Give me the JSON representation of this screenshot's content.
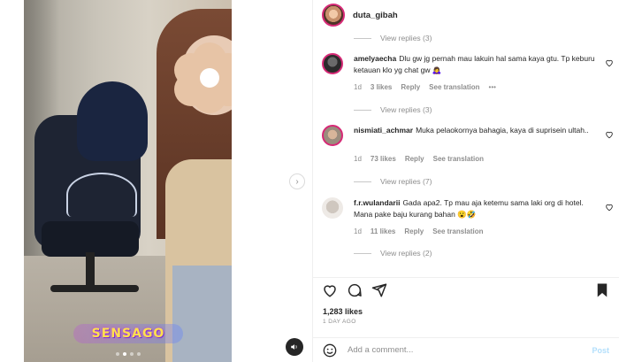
{
  "header": {
    "username": "duta_gibah"
  },
  "media": {
    "sticker_text": "SENSAGO",
    "carousel_pages": 4,
    "active_page": 2
  },
  "top_view_replies": "View replies (3)",
  "comments": [
    {
      "username": "amelyaecha",
      "text": "Dlu gw jg pernah mau lakuin hal sama kaya gtu. Tp keburu ketauan klo yg chat gw 🙇‍♀️",
      "time": "1d",
      "likes": "3 likes",
      "reply": "Reply",
      "translate": "See translation",
      "more": "•••",
      "view_replies": "View replies (3)"
    },
    {
      "username": "nismiati_achmar",
      "text": "Muka pelaokornya bahagia, kaya di suprisein ultah..",
      "time": "1d",
      "likes": "73 likes",
      "reply": "Reply",
      "translate": "See translation",
      "view_replies": "View replies (7)"
    },
    {
      "username": "f.r.wulandarii",
      "text": "Gada apa2. Tp mau aja ketemu sama laki org di hotel. Mana pake baju kurang bahan 😮🤣",
      "time": "1d",
      "likes": "11 likes",
      "reply": "Reply",
      "translate": "See translation",
      "view_replies": "View replies (2)"
    }
  ],
  "post": {
    "likes": "1,283 likes",
    "date": "1 DAY AGO"
  },
  "add_comment": {
    "placeholder": "Add a comment...",
    "post_label": "Post"
  },
  "colors": {
    "text": "#262626",
    "muted": "#8e8e8e",
    "post_button_disabled": "#b2dffc",
    "story_ring": "#d62976"
  }
}
